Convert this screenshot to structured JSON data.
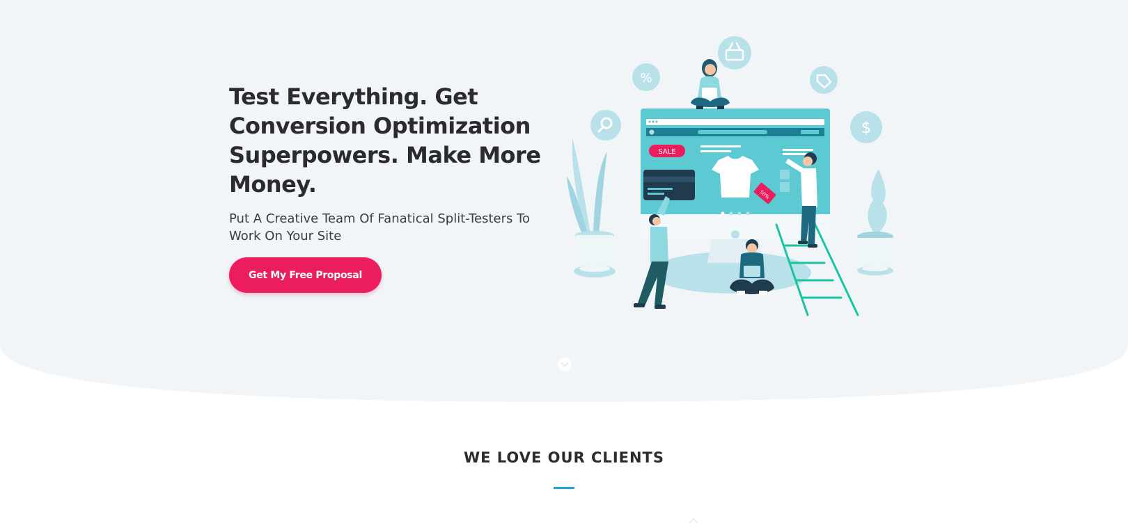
{
  "hero": {
    "title": "Test Everything. Get Conversion Optimization Superpowers. Make More Money.",
    "subtitle": "Put A Creative Team Of Fanatical Split-Testers To Work On Your Site",
    "cta_label": "Get My Free Proposal"
  },
  "illustration": {
    "sale_badge": "SALE",
    "price_tag": "50%",
    "percent_bubble": "%",
    "dollar_bubble": "$"
  },
  "clients": {
    "heading": "WE LOVE OUR CLIENTS"
  },
  "colors": {
    "hero_background": "#f1f5f8",
    "accent_pink": "#eb1d5e",
    "accent_blue": "#1ba7d9",
    "heading_text": "#2b2b2f",
    "illustration_teal": "#5cc9d3",
    "illustration_light": "#b9e1ea"
  }
}
